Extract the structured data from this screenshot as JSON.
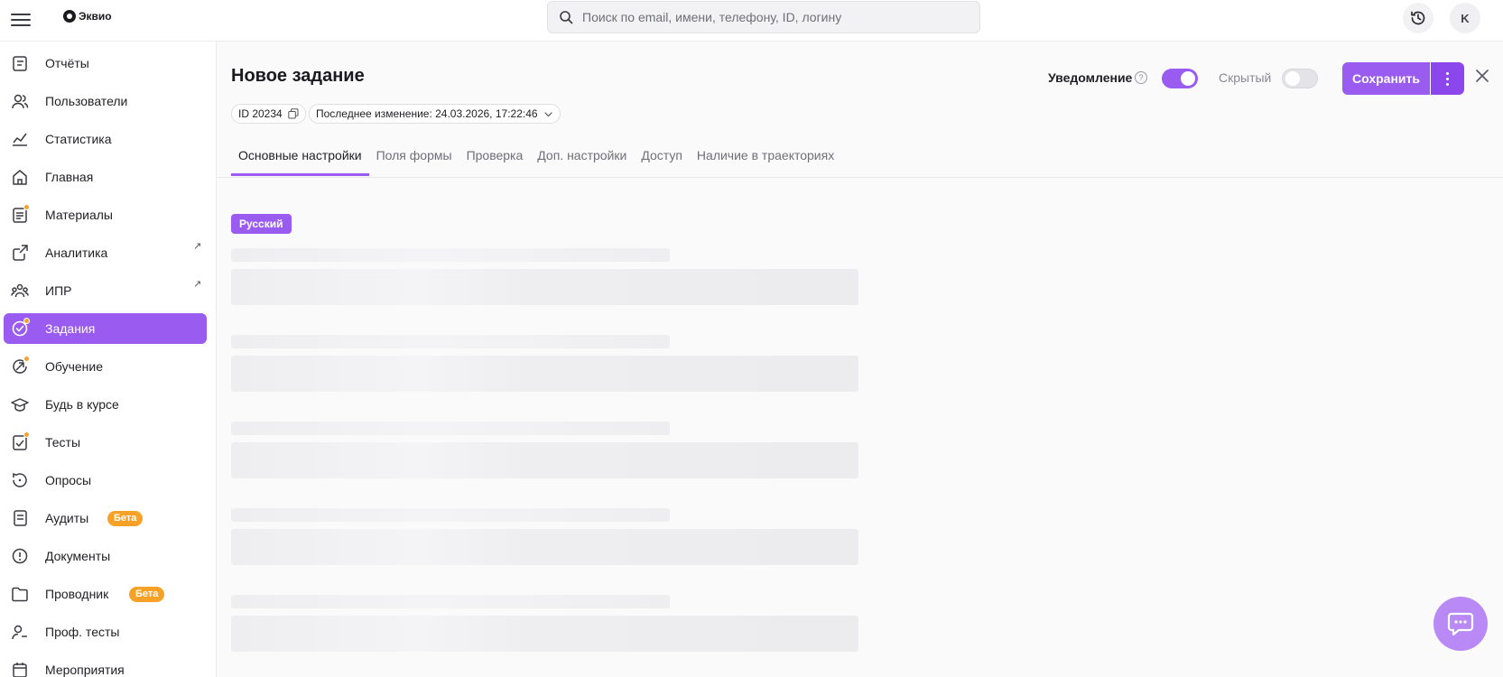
{
  "topbar": {
    "logo_text": "Эквио",
    "search_placeholder": "Поиск по email, имени, телефону, ID, логину",
    "avatar_initial": "K"
  },
  "sidebar": {
    "items": [
      {
        "label": "Отчёты",
        "icon": "reports-icon"
      },
      {
        "label": "Пользователи",
        "icon": "users-icon"
      },
      {
        "label": "Статистика",
        "icon": "chart-icon"
      },
      {
        "label": "Главная",
        "icon": "home-icon"
      },
      {
        "label": "Материалы",
        "icon": "materials-icon",
        "dot": true
      },
      {
        "label": "Аналитика",
        "icon": "external-link-icon",
        "external": true
      },
      {
        "label": "ИПР",
        "icon": "team-icon",
        "external": true
      },
      {
        "label": "Задания",
        "icon": "tasks-icon",
        "active": true,
        "dot": true
      },
      {
        "label": "Обучение",
        "icon": "learning-icon",
        "dot": true
      },
      {
        "label": "Будь в курсе",
        "icon": "graduation-cap-icon"
      },
      {
        "label": "Тесты",
        "icon": "tests-icon",
        "dot": true
      },
      {
        "label": "Опросы",
        "icon": "polls-icon"
      },
      {
        "label": "Аудиты",
        "icon": "audits-icon",
        "badge": "Бета"
      },
      {
        "label": "Документы",
        "icon": "documents-icon"
      },
      {
        "label": "Проводник",
        "icon": "folder-icon",
        "badge": "Бета"
      },
      {
        "label": "Проф. тесты",
        "icon": "prof-tests-icon"
      },
      {
        "label": "Мероприятия",
        "icon": "calendar-icon"
      }
    ]
  },
  "header": {
    "title": "Новое задание",
    "notification_label": "Уведомление",
    "notification_on": true,
    "hidden_label": "Скрытый",
    "hidden_on": false,
    "save_label": "Сохранить"
  },
  "meta": {
    "id_label": "ID 20234",
    "last_change_label": "Последнее изменение: 24.03.2026, 17:22:46"
  },
  "tabs": [
    {
      "label": "Основные настройки",
      "active": true
    },
    {
      "label": "Поля формы"
    },
    {
      "label": "Проверка"
    },
    {
      "label": "Доп. настройки"
    },
    {
      "label": "Доступ"
    },
    {
      "label": "Наличие в траекториях"
    }
  ],
  "language_badge": "Русский",
  "colors": {
    "accent": "#9a5cf0",
    "badge": "#f7a227",
    "skeleton": "#eeeef0"
  }
}
